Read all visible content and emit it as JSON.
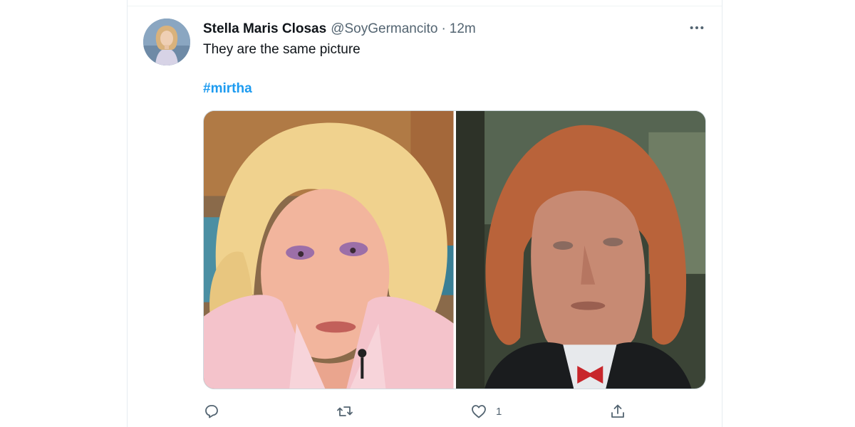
{
  "tweet": {
    "display_name": "Stella Maris Closas",
    "handle": "@SoyGermancito",
    "separator": "·",
    "time": "12m",
    "text": "They are the same picture",
    "hashtag": "#mirtha",
    "more_icon": "more-horizontal-icon",
    "media": [
      {
        "description_icon": "photo-woman-blonde"
      },
      {
        "description_icon": "photo-man-red-hair"
      }
    ]
  },
  "actions": {
    "reply": {
      "icon": "reply-icon",
      "count": ""
    },
    "retweet": {
      "icon": "retweet-icon",
      "count": ""
    },
    "like": {
      "icon": "like-icon",
      "count": "1"
    },
    "share": {
      "icon": "share-icon",
      "count": ""
    }
  },
  "colors": {
    "accent": "#1d9bf0",
    "text_primary": "#0f1419",
    "text_secondary": "#536471",
    "border": "#cfd9de"
  }
}
